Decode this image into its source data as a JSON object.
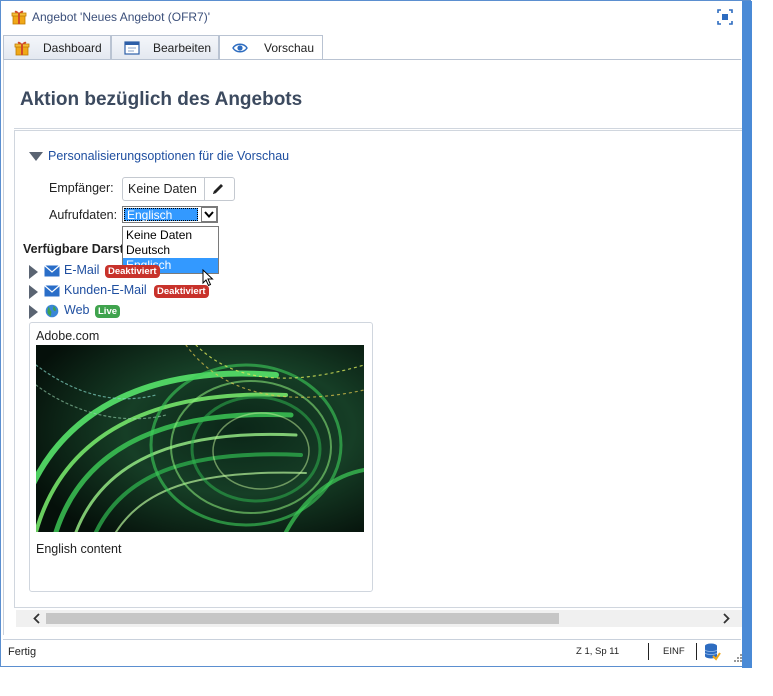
{
  "window": {
    "title": "Angebot 'Neues Angebot (OFR7)'"
  },
  "tabs": [
    {
      "label": "Dashboard",
      "icon": "gift-icon"
    },
    {
      "label": "Bearbeiten",
      "icon": "form-window-icon"
    },
    {
      "label": "Vorschau",
      "icon": "eye-icon",
      "active": true
    }
  ],
  "main": {
    "title": "Aktion bezüglich des Angebots",
    "personalization": {
      "header": "Personalisierungsoptionen für die Vorschau",
      "recipient_label": "Empfänger:",
      "recipient_value": "Keine Daten",
      "calldata_label": "Aufrufdaten:",
      "calldata_selected": "Englisch",
      "calldata_options": [
        "Keine Daten",
        "Deutsch",
        "Englisch"
      ]
    },
    "available_label": "Verfügbare Darstellungen",
    "channels": [
      {
        "label": "E-Mail",
        "badge": "Deaktiviert",
        "badge_color": "#c8322b",
        "icon": "envelope-icon"
      },
      {
        "label": "Kunden-E-Mail",
        "badge": "Deaktiviert",
        "badge_color": "#c8322b",
        "icon": "envelope-icon"
      },
      {
        "label": "Web",
        "badge": "Live",
        "badge_color": "#3fa34d",
        "icon": "globe-icon"
      }
    ],
    "preview": {
      "site": "Adobe.com",
      "content": "English content"
    }
  },
  "status": {
    "text": "Fertig",
    "position": "Z 1, Sp 11",
    "mode": "EINF"
  }
}
